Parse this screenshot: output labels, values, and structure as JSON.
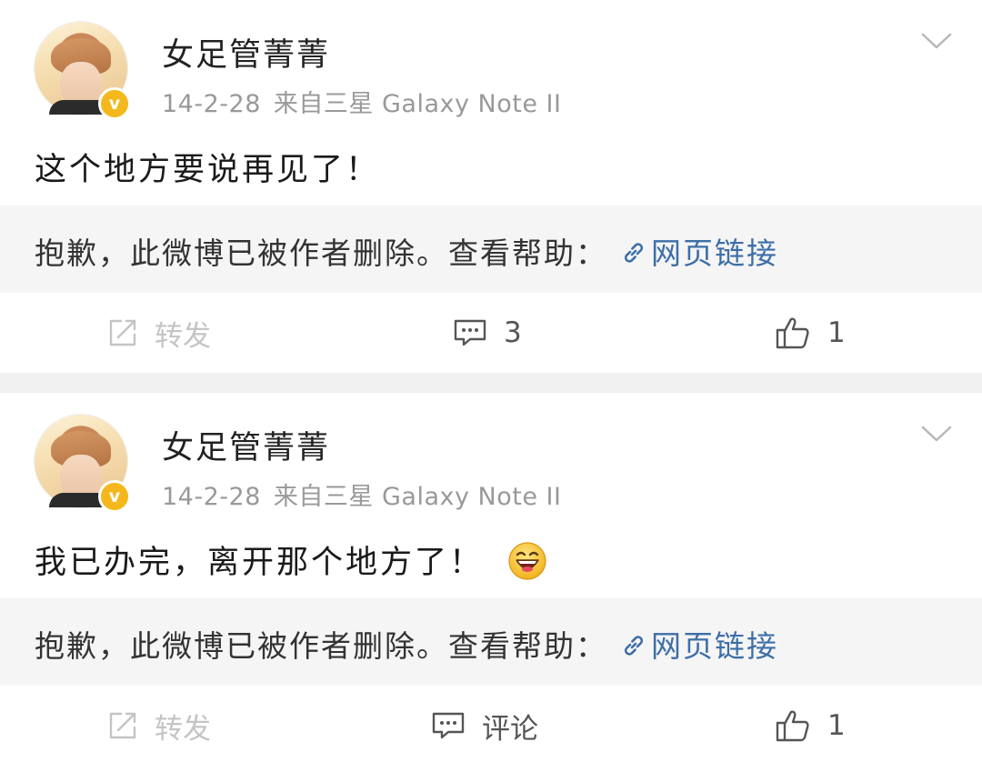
{
  "posts": [
    {
      "username": "女足管菁菁",
      "date": "14-2-28",
      "source": "来自三星 Galaxy Note II",
      "verified_badge": "v",
      "content": "这个地方要说再见了！",
      "emoji": "",
      "deleted_notice": "抱歉，此微博已被作者删除。查看帮助：",
      "help_link": "网页链接",
      "repost_label": "转发",
      "comment_label": "3",
      "like_count": "1"
    },
    {
      "username": "女足管菁菁",
      "date": "14-2-28",
      "source": "来自三星 Galaxy Note II",
      "verified_badge": "v",
      "content": "我已办完，离开那个地方了！",
      "emoji": "laughing-face",
      "deleted_notice": "抱歉，此微博已被作者删除。查看帮助：",
      "help_link": "网页链接",
      "repost_label": "转发",
      "comment_label": "评论",
      "like_count": "1"
    }
  ],
  "colors": {
    "link": "#3d6ea7",
    "badge": "#f4b81c",
    "meta": "#999999",
    "deleted_bg": "#f5f5f5",
    "separator": "#f0f0f0"
  },
  "icons": {
    "chevron": "chevron-down-icon",
    "link": "link-icon",
    "repost": "share-icon",
    "comment": "comment-icon",
    "like": "thumbs-up-icon",
    "verified": "verified-badge-icon"
  }
}
